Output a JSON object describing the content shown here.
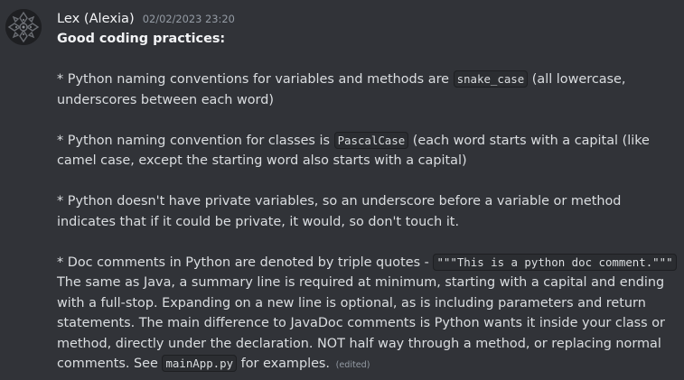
{
  "message": {
    "author": "Lex (Alexia)",
    "timestamp": "02/02/2023 23:20",
    "heading": "Good coding practices:",
    "p1_pre": "* Python naming conventions for variables and methods are",
    "p1_code": "snake_case",
    "p1_post": "(all lowercase, underscores between each word)",
    "p2_pre": "* Python naming convention for classes is",
    "p2_code": "PascalCase",
    "p2_post": "(each word starts with a capital (like camel case, except the starting word also starts with a capital)",
    "p3": "* Python doesn't have private variables, so an underscore before a variable or method indicates that if it could be private, it would, so don't touch it.",
    "p4_pre": "* Doc comments in Python are denoted by triple quotes -",
    "p4_code": "\"\"\"This is a python doc comment.\"\"\"",
    "p4_body": "The same as Java, a summary line is required at minimum, starting with a capital and ending with a full-stop. Expanding on a new line is optional, as is including parameters and return statements. The main difference to JavaDoc comments is Python wants it inside your class or method, directly under the declaration. NOT half way through a method, or replacing normal comments. See",
    "p4_code2": "mainApp.py",
    "p4_tail": "for examples.",
    "edited_label": "(edited)"
  },
  "colors": {
    "background": "#313338",
    "text": "#dbdee1",
    "author": "#f2f3f5",
    "muted": "#949ba4",
    "code_bg": "#2b2d31"
  },
  "icons": {
    "avatar": "user-avatar-icon"
  }
}
